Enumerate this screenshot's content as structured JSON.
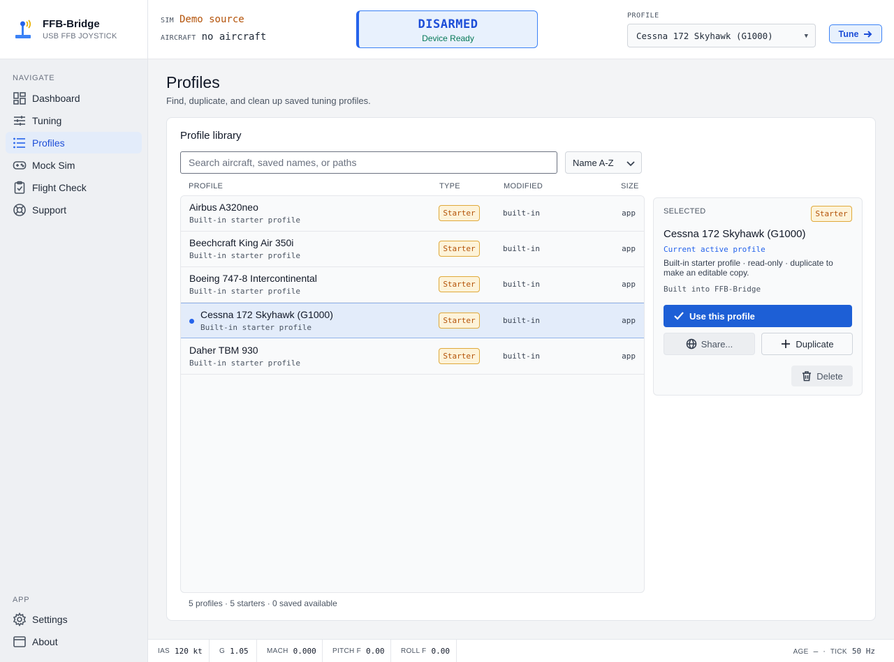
{
  "app": {
    "name": "FFB-Bridge",
    "subtitle": "USB FFB JOYSTICK"
  },
  "sidebar": {
    "navigate_label": "NAVIGATE",
    "items": [
      {
        "label": "Dashboard",
        "icon": "dashboard-icon"
      },
      {
        "label": "Tuning",
        "icon": "sliders-icon"
      },
      {
        "label": "Profiles",
        "icon": "list-icon",
        "active": true
      },
      {
        "label": "Mock Sim",
        "icon": "gamepad-icon"
      },
      {
        "label": "Flight Check",
        "icon": "clipboard-check-icon"
      },
      {
        "label": "Support",
        "icon": "lifebuoy-icon"
      }
    ],
    "app_label": "APP",
    "app_items": [
      {
        "label": "Settings",
        "icon": "gear-icon"
      },
      {
        "label": "About",
        "icon": "window-icon"
      }
    ]
  },
  "topbar": {
    "sim_key": "SIM",
    "sim_value": "Demo source",
    "aircraft_key": "AIRCRAFT",
    "aircraft_value": "no aircraft",
    "status_main": "DISARMED",
    "status_sub": "Device Ready",
    "profile_label": "PROFILE",
    "profile_value": "Cessna 172 Skyhawk (G1000)",
    "tune_label": "Tune"
  },
  "page": {
    "title": "Profiles",
    "subtitle": "Find, duplicate, and clean up saved tuning profiles."
  },
  "library": {
    "title": "Profile library",
    "search_placeholder": "Search aircraft, saved names, or paths",
    "sort_value": "Name A-Z",
    "columns": {
      "profile": "PROFILE",
      "type": "TYPE",
      "modified": "MODIFIED",
      "size": "SIZE"
    },
    "rows": [
      {
        "name": "Airbus A320neo",
        "sub": "Built-in starter profile",
        "type": "Starter",
        "modified": "built-in",
        "size": "app"
      },
      {
        "name": "Beechcraft King Air 350i",
        "sub": "Built-in starter profile",
        "type": "Starter",
        "modified": "built-in",
        "size": "app"
      },
      {
        "name": "Boeing 747-8 Intercontinental",
        "sub": "Built-in starter profile",
        "type": "Starter",
        "modified": "built-in",
        "size": "app"
      },
      {
        "name": "Cessna 172 Skyhawk (G1000)",
        "sub": "Built-in starter profile",
        "type": "Starter",
        "modified": "built-in",
        "size": "app",
        "selected": true
      },
      {
        "name": "Daher TBM 930",
        "sub": "Built-in starter profile",
        "type": "Starter",
        "modified": "built-in",
        "size": "app"
      }
    ],
    "footer": "5 profiles · 5 starters · 0 saved available"
  },
  "detail": {
    "label": "SELECTED",
    "badge": "Starter",
    "name": "Cessna 172 Skyhawk (G1000)",
    "active_note": "Current active profile",
    "description": "Built-in starter profile · read-only · duplicate to make an editable copy.",
    "built": "Built into FFB-Bridge",
    "use_label": "Use this profile",
    "share_label": "Share...",
    "duplicate_label": "Duplicate",
    "delete_label": "Delete"
  },
  "statusbar": {
    "ias_key": "IAS",
    "ias_value": "120 kt",
    "g_key": "G",
    "g_value": "1.05",
    "mach_key": "MACH",
    "mach_value": "0.000",
    "pitch_key": "PITCH F",
    "pitch_value": "0.00",
    "roll_key": "ROLL F",
    "roll_value": "0.00",
    "age_key": "AGE",
    "age_value": "—",
    "sep": "·",
    "tick_key": "TICK",
    "tick_value": "50 Hz"
  },
  "colors": {
    "accent": "#1d5fd6",
    "sim_source": "#b45309",
    "ready": "#047857",
    "badge": "#b45309"
  }
}
